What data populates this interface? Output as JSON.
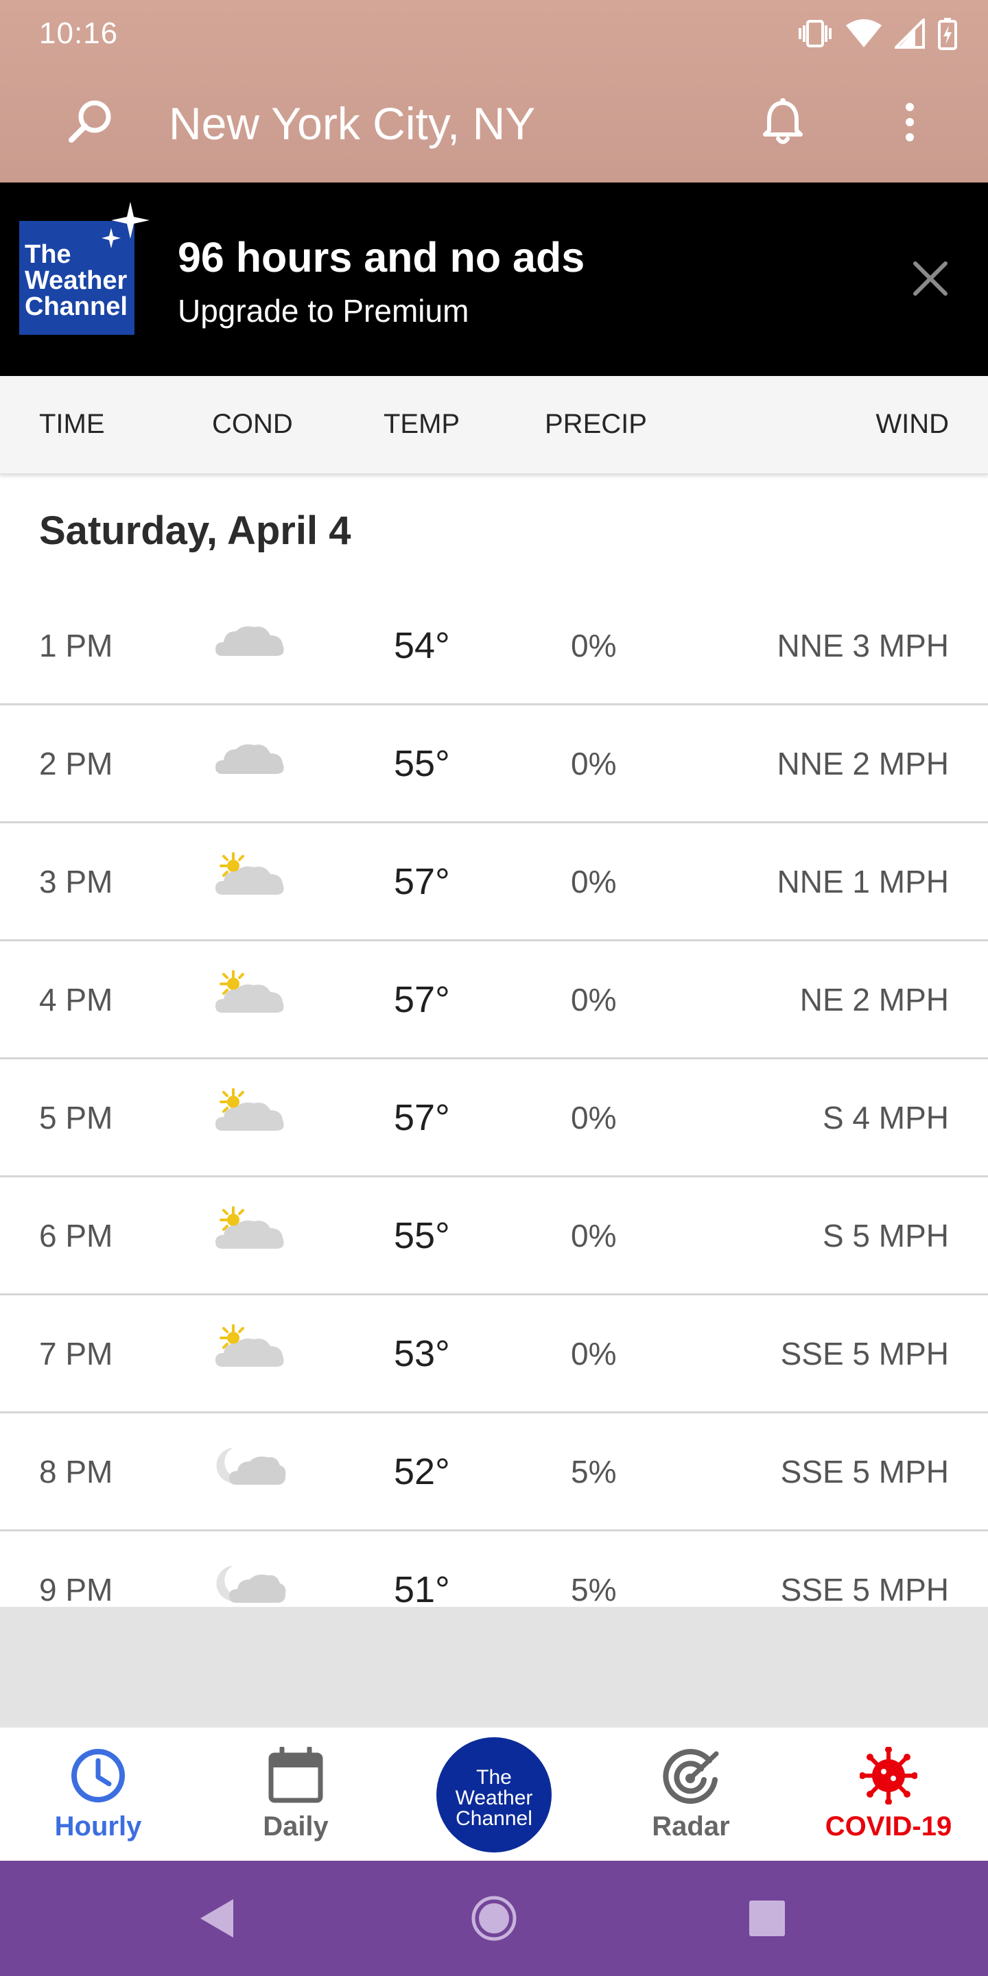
{
  "status_bar": {
    "time": "10:16"
  },
  "app_bar": {
    "location": "New York City, NY"
  },
  "promo": {
    "logo_lines": [
      "The",
      "Weather",
      "Channel"
    ],
    "title": "96 hours and no ads",
    "subtitle": "Upgrade to Premium"
  },
  "columns": {
    "time": "TIME",
    "cond": "COND",
    "temp": "TEMP",
    "precip": "PRECIP",
    "wind": "WIND"
  },
  "day_heading": "Saturday, April 4",
  "rows": [
    {
      "time": "1 PM",
      "icon": "cloudy-icon",
      "temp": "54°",
      "precip": "0%",
      "wind": "NNE 3 MPH"
    },
    {
      "time": "2 PM",
      "icon": "cloudy-icon",
      "temp": "55°",
      "precip": "0%",
      "wind": "NNE 2 MPH"
    },
    {
      "time": "3 PM",
      "icon": "partly-sunny-icon",
      "temp": "57°",
      "precip": "0%",
      "wind": "NNE 1 MPH"
    },
    {
      "time": "4 PM",
      "icon": "partly-sunny-icon",
      "temp": "57°",
      "precip": "0%",
      "wind": "NE 2 MPH"
    },
    {
      "time": "5 PM",
      "icon": "partly-sunny-icon",
      "temp": "57°",
      "precip": "0%",
      "wind": "S 4 MPH"
    },
    {
      "time": "6 PM",
      "icon": "partly-sunny-icon",
      "temp": "55°",
      "precip": "0%",
      "wind": "S 5 MPH"
    },
    {
      "time": "7 PM",
      "icon": "partly-sunny-icon",
      "temp": "53°",
      "precip": "0%",
      "wind": "SSE 5 MPH"
    },
    {
      "time": "8 PM",
      "icon": "partly-cloudy-night-icon",
      "temp": "52°",
      "precip": "5%",
      "wind": "SSE 5 MPH"
    },
    {
      "time": "9 PM",
      "icon": "partly-cloudy-night-icon",
      "temp": "51°",
      "precip": "5%",
      "wind": "SSE 5 MPH"
    }
  ],
  "bottom_nav": {
    "hourly": "Hourly",
    "daily": "Daily",
    "center_logo_lines": [
      "The",
      "Weather",
      "Channel"
    ],
    "radar": "Radar",
    "covid": "COVID-19"
  },
  "colors": {
    "header": "#d4a698",
    "active_tab": "#3c6ee0",
    "inactive_tab": "#666666",
    "covid": "#e8000b",
    "center_logo": "#0b2b9a",
    "system_nav": "#724598"
  }
}
